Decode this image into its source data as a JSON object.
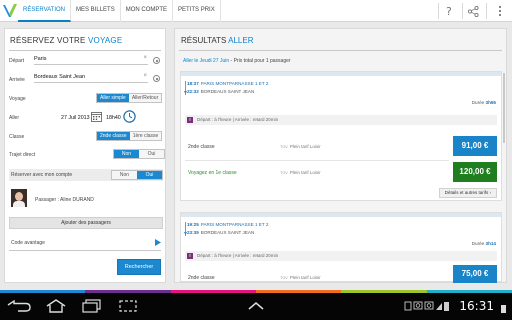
{
  "topbar": {
    "tabs": [
      {
        "label": "RÉSERVATION",
        "active": true
      },
      {
        "label": "MES BILLETS",
        "active": false
      },
      {
        "label": "MON COMPTE",
        "active": false
      },
      {
        "label": "PETITS PRIX",
        "active": false
      }
    ],
    "icons": [
      "help-icon",
      "share-icon",
      "overflow-menu-icon"
    ],
    "accent": "#0a7fc5"
  },
  "left": {
    "title_prefix": "Réservez votre",
    "title_accent": "VOYAGE",
    "depart_label": "Départ",
    "depart_value": "Paris",
    "arrivee_label": "Arrivée",
    "arrivee_value": "Bordeaux Saint Jean",
    "voyage_label": "Voyage",
    "voyage_options": [
      "Aller simple",
      "Aller/Retour"
    ],
    "aller_label": "Aller",
    "aller_date": "27 Juil 2013",
    "aller_time": "18h40",
    "classe_label": "Classe",
    "classe_options": [
      "2nde classe",
      "1ère classe"
    ],
    "trajet_label": "Trajet direct",
    "trajet_options": [
      "Non",
      "Oui"
    ],
    "compte_label": "Réserver avec mon compte",
    "compte_options": [
      "Non",
      "Oui"
    ],
    "passager": "Passager : Aline DURAND",
    "add_passengers": "Ajouter des passagers",
    "code_avantage": "Code avantage",
    "search_button": "Rechercher"
  },
  "right": {
    "title_prefix": "Résultats",
    "title_accent": "ALLER",
    "subtitle_blue": "Aller le Jeudi 27 Juin",
    "subtitle_rest": "  -  Prix total pour 1 passager",
    "trains": [
      {
        "dep_time": "18:37",
        "dep_station": "PARIS MONTPARNASSE 1 ET 2",
        "arr_time": "22:32",
        "arr_station": "BORDEAUX SAINT JEAN",
        "duree_label": "Durée",
        "duree": "3h55",
        "info": "Départ : à l'heure | Arrivée : retard 20min",
        "rows": [
          {
            "label": "2nde classe",
            "tarif": "Plein tarif Loisir",
            "price": "91,00 €",
            "style": "blue"
          },
          {
            "label": "Voyagez en 1e classe",
            "tarif": "Plein tarif Loisir",
            "price": "120,00 €",
            "style": "green"
          }
        ],
        "details": "Détails et autres tarifs"
      },
      {
        "dep_time": "19:25",
        "dep_station": "PARIS MONTPARNASSE 1 ET 2",
        "arr_time": "23:39",
        "arr_station": "BORDEAUX SAINT JEAN",
        "duree_label": "Durée",
        "duree": "3h14",
        "info": "Départ : à l'heure | Arrivée : retard 20min",
        "rows": [
          {
            "label": "2nde classe",
            "tarif": "Plein tarif Loisir",
            "price": "75,00 €",
            "style": "blue"
          }
        ]
      }
    ],
    "tgv_tag": "TGV"
  },
  "status": {
    "time": "16:31",
    "stripe_colors": [
      "#1e88d5",
      "#6f2e8e",
      "#e6137f",
      "#ef6d1f",
      "#9fc32b",
      "#1fb0c8"
    ]
  }
}
